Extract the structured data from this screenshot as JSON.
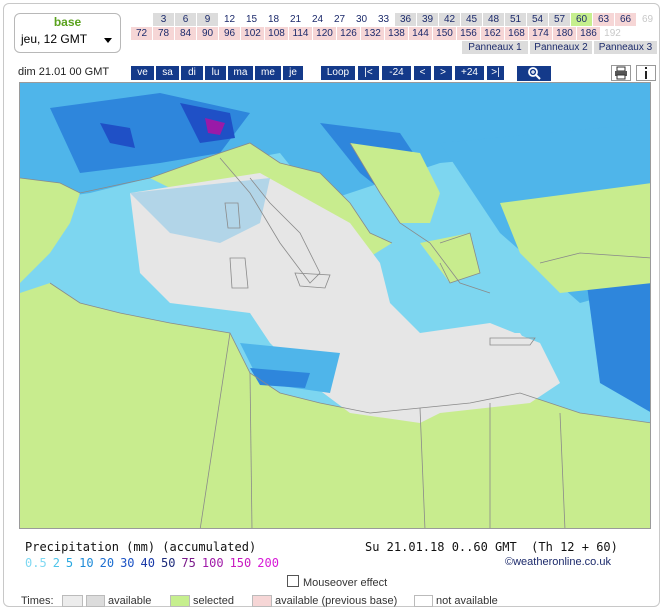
{
  "base": {
    "label": "base",
    "selected": "jeu, 12 GMT"
  },
  "hours_row1": [
    {
      "v": "3",
      "s": "avail"
    },
    {
      "v": "6",
      "s": "avail"
    },
    {
      "v": "9",
      "s": "avail"
    },
    {
      "v": "12",
      "s": "white"
    },
    {
      "v": "15",
      "s": "white"
    },
    {
      "v": "18",
      "s": "white"
    },
    {
      "v": "21",
      "s": "white"
    },
    {
      "v": "24",
      "s": "white"
    },
    {
      "v": "27",
      "s": "white"
    },
    {
      "v": "30",
      "s": "white"
    },
    {
      "v": "33",
      "s": "white"
    },
    {
      "v": "36",
      "s": "avail"
    },
    {
      "v": "39",
      "s": "avail"
    },
    {
      "v": "42",
      "s": "avail"
    },
    {
      "v": "45",
      "s": "avail"
    },
    {
      "v": "48",
      "s": "avail"
    },
    {
      "v": "51",
      "s": "avail"
    },
    {
      "v": "54",
      "s": "avail"
    },
    {
      "v": "57",
      "s": "avail"
    },
    {
      "v": "60",
      "s": "sel"
    },
    {
      "v": "63",
      "s": "prev"
    },
    {
      "v": "66",
      "s": "prev"
    },
    {
      "v": "69",
      "s": "none"
    }
  ],
  "hours_row2": [
    {
      "v": "72",
      "s": "prev"
    },
    {
      "v": "78",
      "s": "prev"
    },
    {
      "v": "84",
      "s": "prev"
    },
    {
      "v": "90",
      "s": "prev"
    },
    {
      "v": "96",
      "s": "prev"
    },
    {
      "v": "102",
      "s": "prev"
    },
    {
      "v": "108",
      "s": "prev"
    },
    {
      "v": "114",
      "s": "prev"
    },
    {
      "v": "120",
      "s": "prev"
    },
    {
      "v": "126",
      "s": "prev"
    },
    {
      "v": "132",
      "s": "prev"
    },
    {
      "v": "138",
      "s": "prev"
    },
    {
      "v": "144",
      "s": "prev"
    },
    {
      "v": "150",
      "s": "prev"
    },
    {
      "v": "156",
      "s": "prev"
    },
    {
      "v": "162",
      "s": "prev"
    },
    {
      "v": "168",
      "s": "prev"
    },
    {
      "v": "174",
      "s": "prev"
    },
    {
      "v": "180",
      "s": "prev"
    },
    {
      "v": "186",
      "s": "prev"
    },
    {
      "v": "192",
      "s": "none"
    }
  ],
  "panels": [
    "Panneaux 1",
    "Panneaux 2",
    "Panneaux 3"
  ],
  "nav": {
    "date_label": "dim 21.01 00 GMT",
    "days": [
      "ve",
      "sa",
      "di",
      "lu",
      "ma",
      "me",
      "je"
    ],
    "loop": "Loop",
    "first": "|<",
    "back24": "-24",
    "prev": "<",
    "next": ">",
    "fwd24": "+24",
    "last": ">|"
  },
  "legend": {
    "title": "Precipitation (mm) (accumulated)",
    "values": [
      {
        "v": "0.5",
        "c": "#7fd8f2"
      },
      {
        "v": "2",
        "c": "#4ec4ea"
      },
      {
        "v": "5",
        "c": "#2aa8e0"
      },
      {
        "v": "10",
        "c": "#1d8ad8"
      },
      {
        "v": "20",
        "c": "#1d6ed0"
      },
      {
        "v": "30",
        "c": "#1b52c4"
      },
      {
        "v": "40",
        "c": "#1a3aa8"
      },
      {
        "v": "50",
        "c": "#1c2a7a"
      },
      {
        "v": "75",
        "c": "#7a1a8a"
      },
      {
        "v": "100",
        "c": "#a01aa8"
      },
      {
        "v": "150",
        "c": "#c81ac0"
      },
      {
        "v": "200",
        "c": "#d81ad8"
      }
    ]
  },
  "run_info": "Su 21.01.18 0..60 GMT  (Th 12 + 60)",
  "credit": "©weatheronline.co.uk",
  "mouseover": "Mouseover effect",
  "times": {
    "label": "Times:",
    "available": "available",
    "selected": "selected",
    "previous": "available (previous base)",
    "not_available": "not available"
  },
  "colors": {
    "nav_bg": "#143a8a",
    "selected": "#c6ef8e",
    "available": "#dcdcdc",
    "previous": "#f6d6d6",
    "land": "#c8ec8e",
    "sea_dry": "#e6e6e6"
  }
}
